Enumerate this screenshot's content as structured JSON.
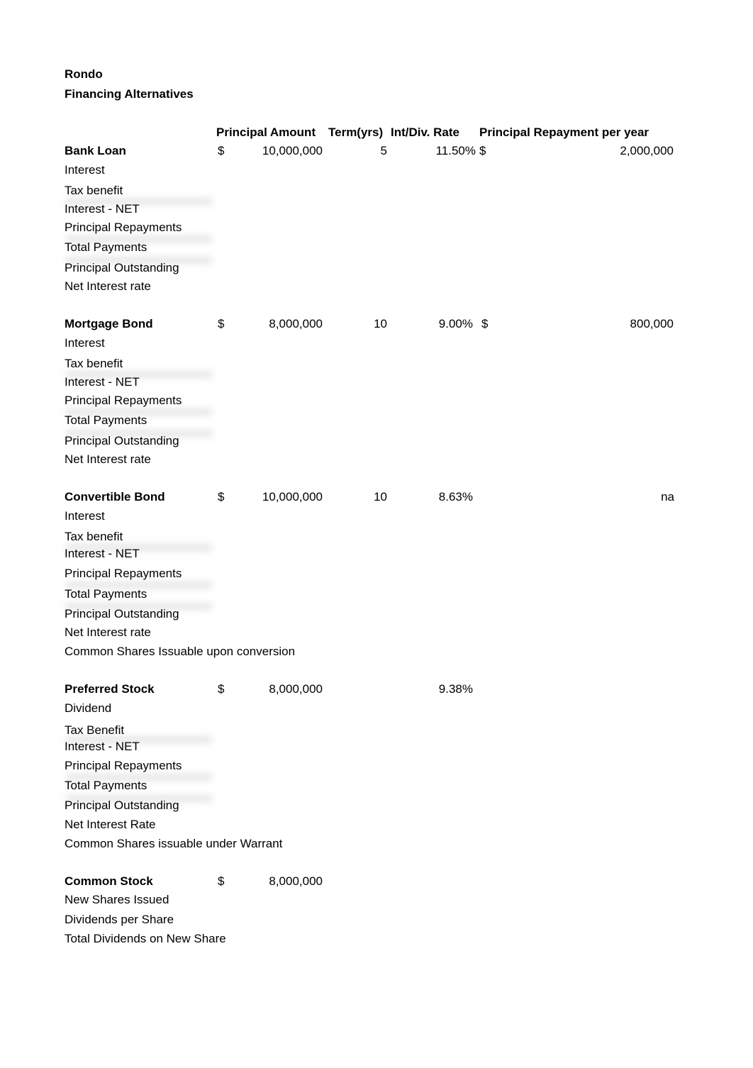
{
  "header": {
    "company": "Rondo",
    "title": "Financing Alternatives"
  },
  "columns": {
    "principal_amount": "Principal Amount",
    "term": "Term(yrs)",
    "rate": "Int/Div. Rate",
    "repayment": "Principal Repayment per year"
  },
  "sections": [
    {
      "name": "Bank Loan",
      "currency": "$",
      "principal": "10,000,000",
      "term": "5",
      "rate": "11.50%",
      "repay_currency": "$",
      "repayment": "2,000,000",
      "rows": [
        "Interest",
        "Tax benefit",
        "Interest - NET",
        "Principal Repayments",
        "Total Payments",
        "Principal Outstanding",
        "Net Interest rate"
      ]
    },
    {
      "name": "Mortgage Bond",
      "currency": "$",
      "principal": "8,000,000",
      "term": "10",
      "rate": "9.00%",
      "repay_currency": "$",
      "repayment": "800,000",
      "rows": [
        "Interest",
        "Tax benefit",
        "Interest - NET",
        "Principal Repayments",
        "Total Payments",
        "Principal Outstanding",
        "Net Interest rate"
      ]
    },
    {
      "name": "Convertible Bond",
      "currency": "$",
      "principal": "10,000,000",
      "term": "10",
      "rate": "8.63%",
      "repayment": "na",
      "rows": [
        "Interest",
        "Tax benefit",
        "Interest - NET",
        "Principal Repayments",
        "Total Payments",
        "Principal Outstanding",
        "Net Interest rate",
        "Common Shares Issuable upon conversion"
      ]
    },
    {
      "name": "Preferred Stock",
      "currency": "$",
      "principal": "8,000,000",
      "rate": "9.38%",
      "rows": [
        "Dividend",
        "Tax Benefit",
        "Interest - NET",
        "Principal Repayments",
        "Total Payments",
        "Principal Outstanding",
        "Net Interest Rate",
        "Common Shares issuable under Warrant"
      ]
    },
    {
      "name": "Common Stock",
      "currency": "$",
      "principal": "8,000,000",
      "rows": [
        "New Shares Issued",
        "Dividends per Share",
        "Total Dividends on New Share"
      ]
    }
  ]
}
